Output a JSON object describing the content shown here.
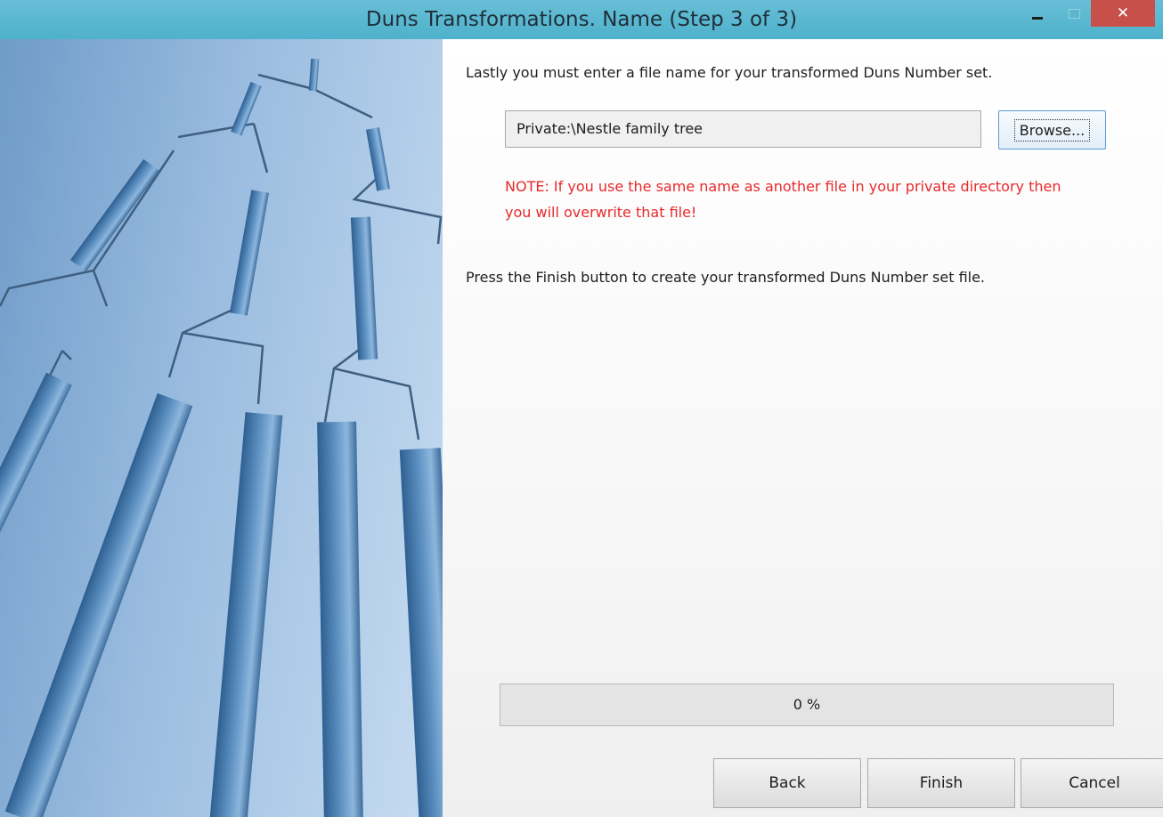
{
  "window": {
    "title": "Duns Transformations.  Name (Step 3 of 3)",
    "controls": {
      "minimize": "minimize-icon",
      "maximize": "maximize-icon",
      "close_glyph": "✕"
    }
  },
  "content": {
    "intro": "Lastly you must enter a file name for your transformed Duns Number set.",
    "file_name_value": "Private:\\Nestle family tree",
    "browse_label": "Browse...",
    "note": "NOTE: If you use the same name as another file in your private directory then you will overwrite that file!",
    "finish_hint": "Press the Finish button to create your transformed Duns Number set file."
  },
  "progress": {
    "value_percent": 0,
    "label": "0 %"
  },
  "buttons": {
    "back": "Back",
    "finish": "Finish",
    "cancel": "Cancel"
  },
  "colors": {
    "titlebar": "#5bb9d1",
    "close_button": "#c7504b",
    "note_text": "#e8292c",
    "focus_border": "#5b9bd5"
  }
}
